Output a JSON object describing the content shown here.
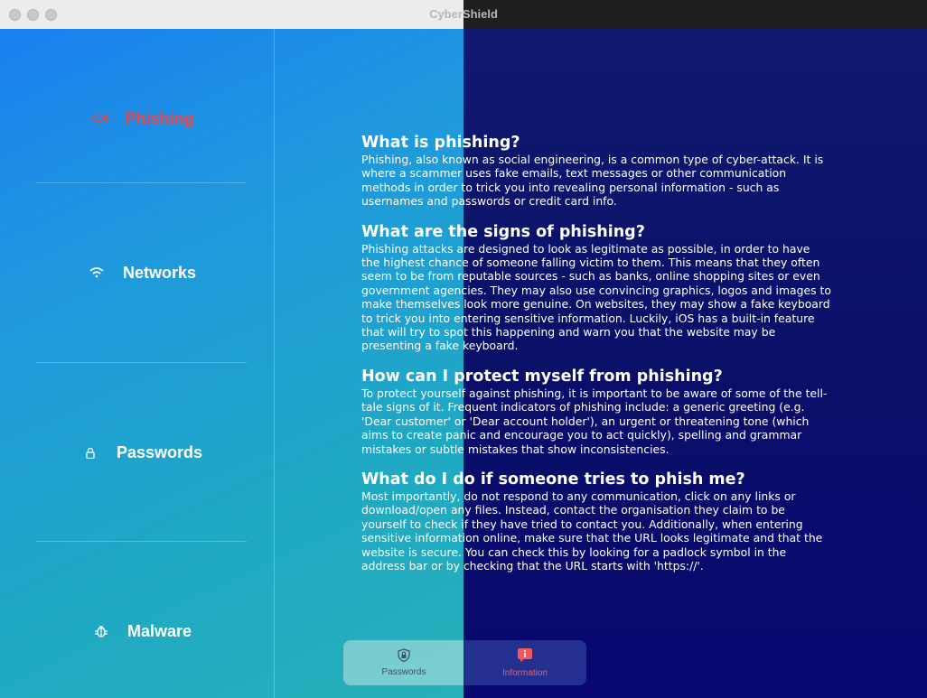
{
  "window": {
    "title": "CyberShield"
  },
  "sidebar": {
    "items": [
      {
        "label": "Phishing",
        "icon": "fish-icon",
        "active": true
      },
      {
        "label": "Networks",
        "icon": "wifi-icon",
        "active": false
      },
      {
        "label": "Passwords",
        "icon": "lock-icon",
        "active": false
      },
      {
        "label": "Malware",
        "icon": "bug-icon",
        "active": false
      }
    ]
  },
  "article": {
    "sections": [
      {
        "heading": "What is phishing?",
        "body": "Phishing, also known as social engineering, is a common type of cyber-attack. It is where a scammer uses fake emails, text messages or other communication methods in order to trick you into revealing personal information - such as usernames and passwords or credit card info."
      },
      {
        "heading": "What are the signs of phishing?",
        "body": "Phishing attacks are designed to look as legitimate as possible, in order to have the highest chance of someone falling victim to them. This means that they often seem to be from reputable sources - such as banks, online shopping sites or even government agencies. They may also use convincing graphics, logos and images to make themselves look more genuine. On websites, they may show a fake keyboard to trick you into entering sensitive information. Luckily, iOS has a built-in feature that will try to spot this happening and warn you that the website may be presenting a fake keyboard."
      },
      {
        "heading": "How can I protect myself from phishing?",
        "body": "To protect yourself against phishing, it is important to be aware of some of the tell-tale signs of it. Frequent indicators of phishing include: a generic greeting (e.g. 'Dear customer' or 'Dear account holder'), an urgent or threatening tone (which aims to create panic and encourage you to act quickly), spelling and grammar mistakes or subtle mistakes that show inconsistencies."
      },
      {
        "heading": "What do I do if someone tries to phish me?",
        "body": "Most importantly, do not respond to any communication, click on any links or download/open any files. Instead, contact the organisation they claim to be yourself to check if they have tried to contact you. Additionally, when entering sensitive information online, make sure that the URL looks legitimate and that the website is secure. You can check this by looking for a padlock symbol in the address bar or by checking that the URL starts with 'https://'."
      }
    ]
  },
  "tabbar": {
    "tabs": [
      {
        "label": "Passwords",
        "icon": "shield-lock-icon",
        "active": false
      },
      {
        "label": "Information",
        "icon": "info-bubble-icon",
        "active": true
      }
    ]
  },
  "colors": {
    "active_accent": "#e8474a",
    "gradient_start": "#1a80f0",
    "gradient_end": "#2db6b0",
    "dark_overlay": "#0a0f68"
  }
}
